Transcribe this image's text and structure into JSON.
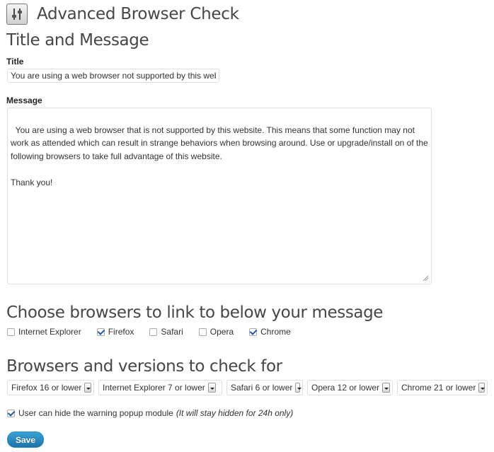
{
  "header": {
    "title": "Advanced Browser Check",
    "icon": "settings-sliders-icon"
  },
  "section_title_message": "Title and Message",
  "title_field": {
    "label": "Title",
    "value": "You are using a web browser not supported by this website!"
  },
  "message_field": {
    "label": "Message",
    "value": "You are using a web browser that is not supported by this website. This means that some function may not work as attended which can result in strange behaviors when browsing around. Use or upgrade/install on of the following browsers to take full advantage of this website.\n\nThank you!"
  },
  "section_title_browsers": "Choose browsers to link to below your message",
  "link_browsers": [
    {
      "label": "Internet Explorer",
      "checked": false
    },
    {
      "label": "Firefox",
      "checked": true
    },
    {
      "label": "Safari",
      "checked": false
    },
    {
      "label": "Opera",
      "checked": false
    },
    {
      "label": "Chrome",
      "checked": true
    }
  ],
  "section_title_versions": "Browsers and versions to check for",
  "version_selects": [
    {
      "value": "Firefox 16 or lower"
    },
    {
      "value": "Internet Explorer 7 or lower"
    },
    {
      "value": "Safari 6 or lower"
    },
    {
      "value": "Opera 12 or lower"
    },
    {
      "value": "Chrome 21 or lower"
    }
  ],
  "hide_option": {
    "checked": true,
    "label": "User can hide the warning popup module",
    "note": "(It will stay hidden for 24h only)"
  },
  "save_label": "Save",
  "colors": {
    "accent": "#2a8bc6",
    "check": "#1e5aa8",
    "title": "#464646"
  }
}
